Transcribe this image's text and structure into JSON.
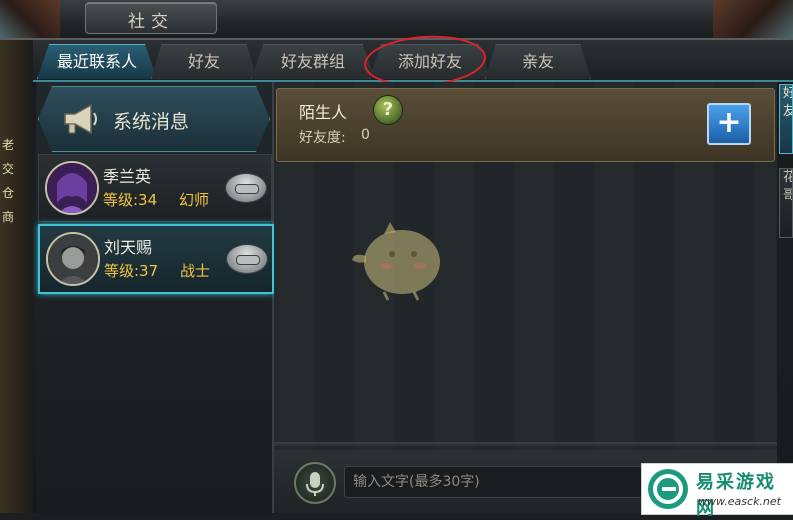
{
  "window": {
    "title": "社交"
  },
  "tabs": [
    {
      "label": "最近联系人",
      "active": true
    },
    {
      "label": "好友",
      "active": false
    },
    {
      "label": "好友群组",
      "active": false
    },
    {
      "label": "添加好友",
      "active": false
    },
    {
      "label": "亲友",
      "active": false
    }
  ],
  "left_panel": {
    "system_message": {
      "label": "系统消息",
      "icon": "horn-icon"
    },
    "contacts": [
      {
        "name": "季兰英",
        "level": "等级:34",
        "class": "幻师",
        "selected": false
      },
      {
        "name": "刘天赐",
        "level": "等级:37",
        "class": "战士",
        "selected": true
      }
    ]
  },
  "stranger_card": {
    "name": "陌生人",
    "affinity_label": "好友度:",
    "affinity_value": "0",
    "help_icon": "question-icon",
    "add_icon": "plus-icon"
  },
  "chat_input": {
    "placeholder": "输入文字(最多30字)",
    "mic_icon": "microphone-icon"
  },
  "side_tabs": [
    {
      "label": "好友"
    },
    {
      "label": "花哥"
    }
  ],
  "left_strip": [
    "老",
    "交",
    "仓",
    "商"
  ],
  "watermark": {
    "title": "易采游戏网",
    "url": "www.easck.net"
  },
  "colors": {
    "accent": "#3fc6d6",
    "level_text": "#f2c53d",
    "annotation_circle": "#e0232b"
  }
}
